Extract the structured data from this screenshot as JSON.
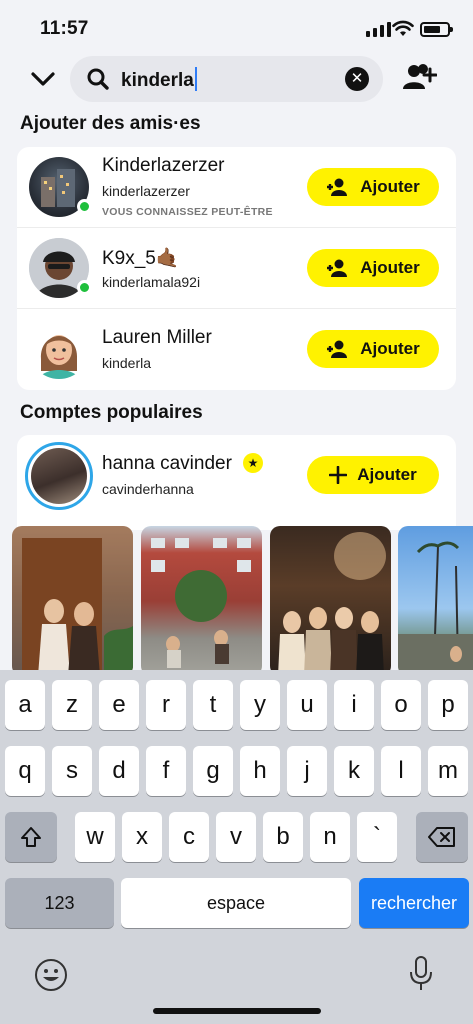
{
  "status": {
    "time": "11:57"
  },
  "search": {
    "query": "kinderla"
  },
  "sections": {
    "add_friends": "Ajouter des amis·es",
    "popular": "Comptes populaires"
  },
  "friends": [
    {
      "name": "Kinderlazerzer",
      "username": "kinderlazerzer",
      "hint": "VOUS CONNAISSEZ PEUT-ÊTRE",
      "online": true,
      "button": "Ajouter"
    },
    {
      "name": "K9x_5🤙🏾",
      "username": "kinderlamala92i",
      "hint": "",
      "online": true,
      "button": "Ajouter"
    },
    {
      "name": "Lauren Miller",
      "username": "kinderla",
      "hint": "",
      "online": false,
      "button": "Ajouter"
    }
  ],
  "popular": [
    {
      "name": "hanna cavinder",
      "username": "cavinderhanna",
      "button": "Ajouter"
    }
  ],
  "keyboard": {
    "row1": [
      "a",
      "z",
      "e",
      "r",
      "t",
      "y",
      "u",
      "i",
      "o",
      "p"
    ],
    "row2": [
      "q",
      "s",
      "d",
      "f",
      "g",
      "h",
      "j",
      "k",
      "l",
      "m"
    ],
    "row3": [
      "w",
      "x",
      "c",
      "v",
      "b",
      "n",
      "`"
    ],
    "numbers": "123",
    "space": "espace",
    "search": "rechercher"
  },
  "colors": {
    "accent_yellow": "#fff200",
    "online_green": "#1fbf3c",
    "key_blue": "#1a7cf5"
  }
}
